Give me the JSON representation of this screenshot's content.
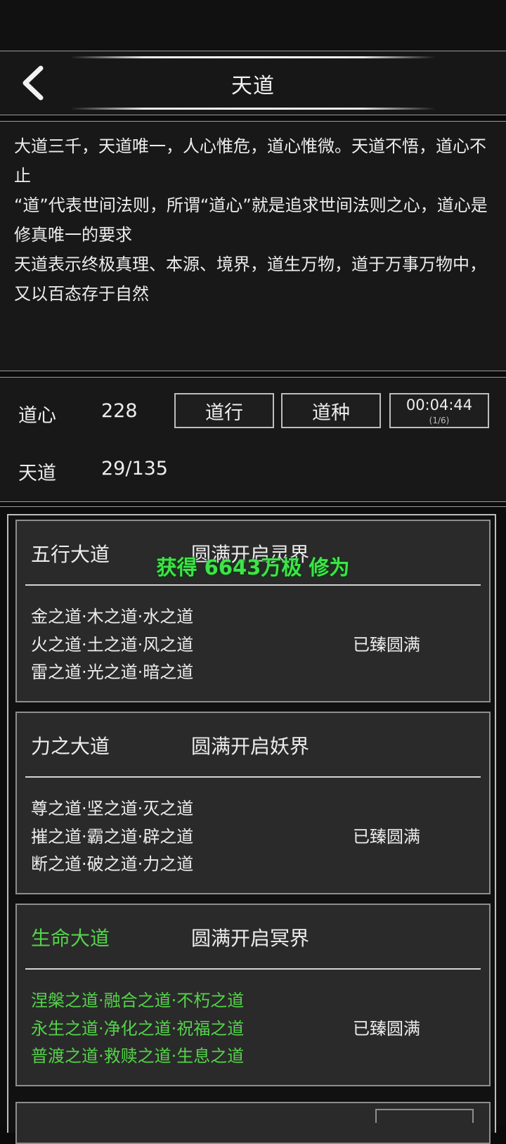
{
  "header": {
    "title": "天道",
    "back_icon": "chevron-left-icon"
  },
  "description": {
    "lines": [
      "大道三千，天道唯一，人心惟危，道心惟微。天道不悟，道心不止",
      "“道”代表世间法则，所谓“道心”就是追求世间法则之心，道心是修真唯一的要求",
      "天道表示终极真理、本源、境界，道生万物，道于万事万物中，又以百态存于自然"
    ]
  },
  "stats": {
    "daoxin_label": "道心",
    "daoxin_value": "228",
    "tiandao_label": "天道",
    "tiandao_value": "29/135",
    "buttons": {
      "daoxing": "道行",
      "daozhong": "道种"
    },
    "timer": {
      "time": "00:04:44",
      "count": "(1/6)"
    }
  },
  "toast": {
    "text": "获得 6643万极 修为",
    "color": "#3ee34a"
  },
  "dao_list": [
    {
      "title": "五行大道",
      "unlock": "圆满开启灵界",
      "daos": [
        "金之道·木之道·水之道",
        "火之道·土之道·风之道",
        "雷之道·光之道·暗之道"
      ],
      "status": "已臻圆满",
      "highlighted": false
    },
    {
      "title": "力之大道",
      "unlock": "圆满开启妖界",
      "daos": [
        "尊之道·坚之道·灭之道",
        "摧之道·霸之道·辟之道",
        "断之道·破之道·力之道"
      ],
      "status": "已臻圆满",
      "highlighted": false
    },
    {
      "title": "生命大道",
      "unlock": "圆满开启冥界",
      "daos": [
        "涅槃之道·融合之道·不朽之道",
        "永生之道·净化之道·祝福之道",
        "普渡之道·救赎之道·生息之道"
      ],
      "status": "已臻圆满",
      "highlighted": true
    }
  ],
  "colors": {
    "highlight_green": "#54d34a",
    "panel_bg": "#181818",
    "card_bg": "#2a2a2a",
    "border": "#9a9a9a"
  }
}
